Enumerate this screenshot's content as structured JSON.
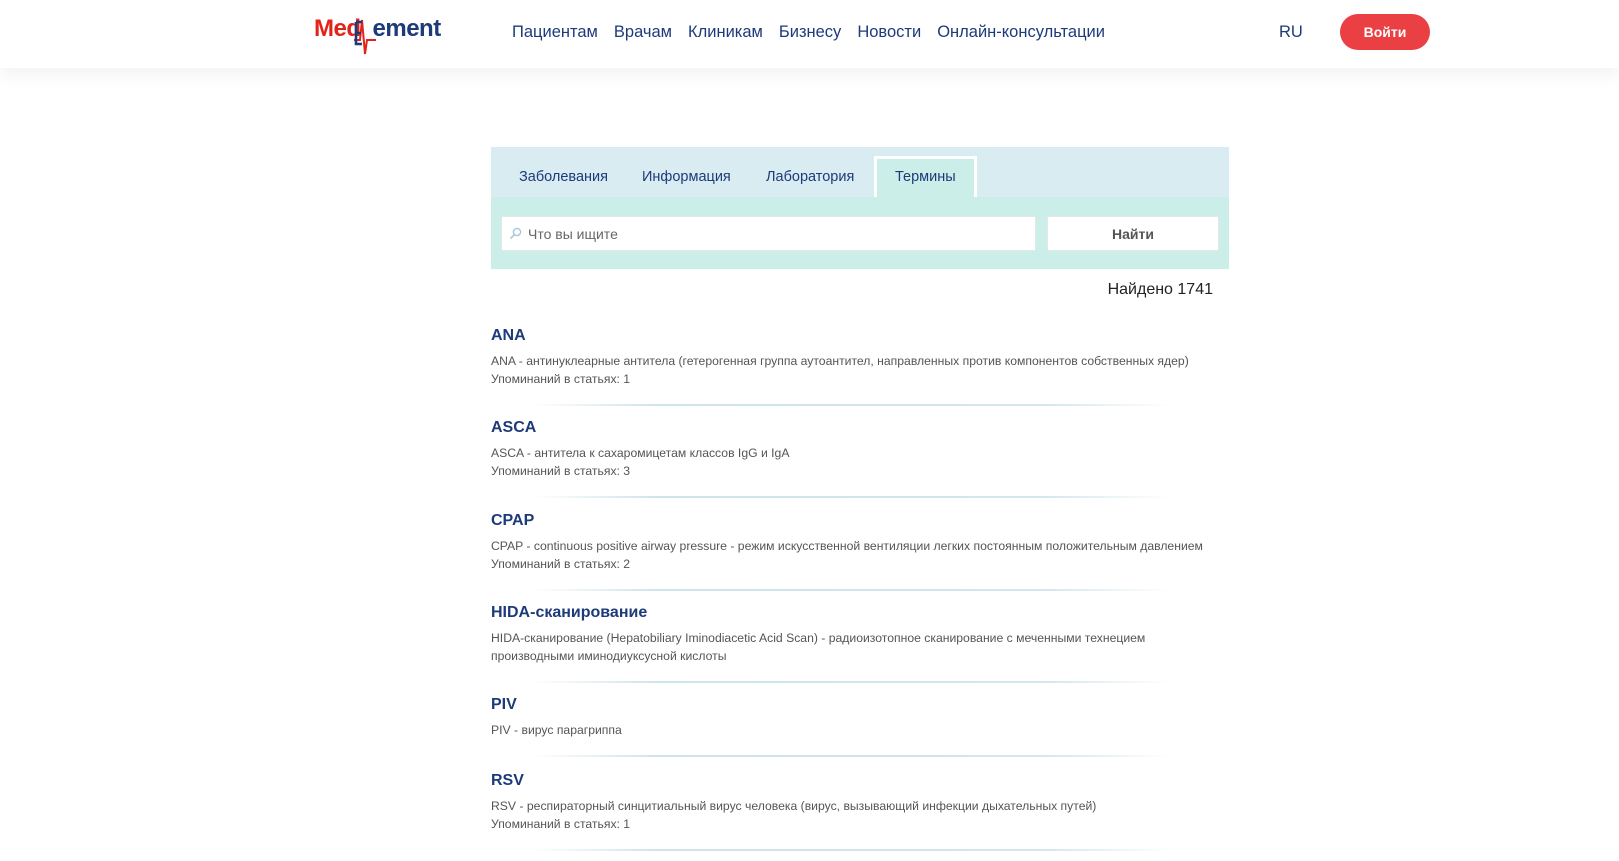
{
  "logo": {
    "part1": "Med",
    "part2": "ement"
  },
  "nav": [
    "Пациентам",
    "Врачам",
    "Клиникам",
    "Бизнесу",
    "Новости",
    "Онлайн-консультации"
  ],
  "lang": "RU",
  "login_label": "Войти",
  "tabs": [
    "Заболевания",
    "Информация",
    "Лаборатория",
    "Термины"
  ],
  "search": {
    "placeholder": "Что вы ищите",
    "button": "Найти"
  },
  "found": "Найдено 1741",
  "results": [
    {
      "title": "ANA",
      "desc": "ANA - антинуклеарные антитела (гетерогенная группа аутоантител, направленных против компонентов собственных ядер)",
      "count": "Упоминаний в статьях: 1"
    },
    {
      "title": "ASCA",
      "desc": "ASCA - антитела к сахаромицетам классов IgG и IgA",
      "count": "Упоминаний в статьях: 3"
    },
    {
      "title": "CPAP",
      "desc": "CPAP - continuous positive airway pressure - режим искусственной вентиляции легких постоянным положительным давлением",
      "count": "Упоминаний в статьях: 2"
    },
    {
      "title": "HIDA-сканирование",
      "desc": "HIDA-сканирование (Hepatobiliary Iminodiacetic Acid Scan) - радиоизотопное сканирование с меченными технецием производными иминодиуксусной кислоты",
      "count": ""
    },
    {
      "title": "PIV",
      "desc": "PIV - вирус парагриппа",
      "count": ""
    },
    {
      "title": "RSV",
      "desc": "RSV - респираторный синцитиальный вирус человека (вирус, вызывающий инфекции дыхательных путей)",
      "count": "Упоминаний в статьях: 1"
    }
  ]
}
